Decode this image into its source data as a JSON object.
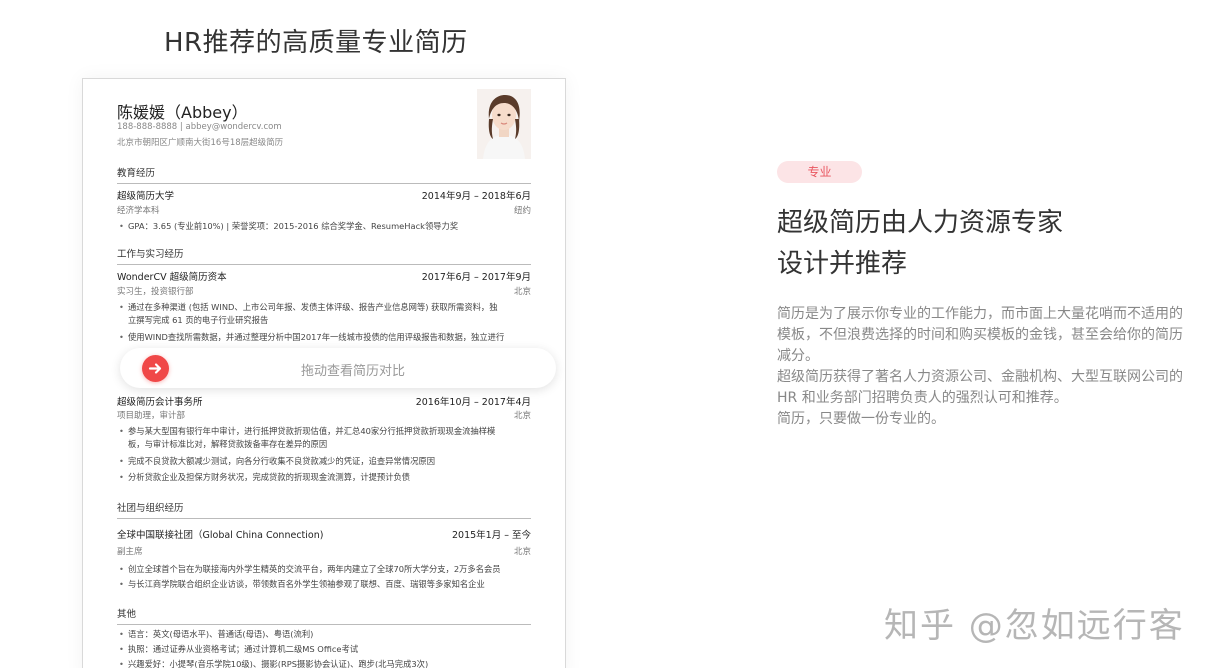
{
  "headline": "HR推荐的高质量专业简历",
  "resume": {
    "name": "陈媛媛（Abbey）",
    "contact": "188-888-8888 | abbey@wondercv.com",
    "address": "北京市朝阳区广顺南大街16号18层超级简历",
    "education": {
      "title": "教育经历",
      "school": "超级简历大学",
      "date": "2014年9月 – 2018年6月",
      "degree": "经济学本科",
      "location": "纽约",
      "bullets": [
        "GPA：3.65 (专业前10%) | 荣誉奖项：2015-2016 综合奖学金、ResumeHack领导力奖"
      ]
    },
    "work": {
      "title": "工作与实习经历",
      "company": "WonderCV 超级简历资本",
      "date": "2017年6月 – 2017年9月",
      "role": "实习生，投资银行部",
      "location": "北京",
      "bullets": [
        "通过在多种渠道 (包括 WIND、上市公司年报、发债主体评级、报告产业信息网等) 获取所需资料，独",
        "立撰写完成 61 页的电子行业研究报告",
        "使用WIND查找所需数据，并通过整理分析中国2017年一线城市投债的信用评级报告和数据，独立进行"
      ]
    },
    "work2": {
      "company": "超级简历会计事务所",
      "date": "2016年10月 – 2017年4月",
      "role": "项目助理，审计部",
      "location": "北京",
      "bullets": [
        "参与某大型国有银行年中审计，进行抵押贷款折现估值，并汇总40家分行抵押贷款折现现金流抽样模",
        "板，与审计标准比对，解释贷款拨备率存在差异的原因",
        "完成不良贷款大额减少测试，向各分行收集不良贷款减少的凭证，追查异常情况原因",
        "分析贷款企业及担保方财务状况，完成贷款的折现现金流测算，计提预计负债"
      ]
    },
    "org": {
      "title": "社团与组织经历",
      "name": "全球中国联接社团（Global China Connection)",
      "date": "2015年1月 – 至今",
      "role": "副主席",
      "location": "北京",
      "bullets": [
        "创立全球首个旨在为联接海内外学生精英的交流平台，两年内建立了全球70所大学分支，2万多名会员",
        "与长江商学院联合组织企业访谈，带领数百名外学生领袖参观了联想、百度、瑞银等多家知名企业"
      ]
    },
    "other": {
      "title": "其他",
      "bullets": [
        "语言：英文(母语水平)、普通话(母语)、粤语(流利)",
        "执照：通过证券从业资格考试；通过计算机二级MS Office考试",
        "兴趣爱好：小提琴(音乐学院10级)、摄影(RPS摄影协会认证)、跑步(北马完成3次)"
      ]
    }
  },
  "slider": {
    "label": "拖动查看简历对比"
  },
  "tag": "专业",
  "title_line1": "超级简历由人力资源专家",
  "title_line2": "设计并推荐",
  "paragraphs": [
    "简历是为了展示你专业的工作能力，而市面上大量花哨而不适用的模板，不但浪费选择的时间和购买模板的金钱，甚至会给你的简历减分。",
    "超级简历获得了著名人力资源公司、金融机构、大型互联网公司的 HR 和业务部门招聘负责人的强烈认可和推荐。",
    "简历，只要做一份专业的。"
  ],
  "watermark": "知乎 @忽如远行客",
  "colors": {
    "accent": "#f04848",
    "tag_bg": "#fce4e6",
    "tag_text": "#e9555f"
  }
}
